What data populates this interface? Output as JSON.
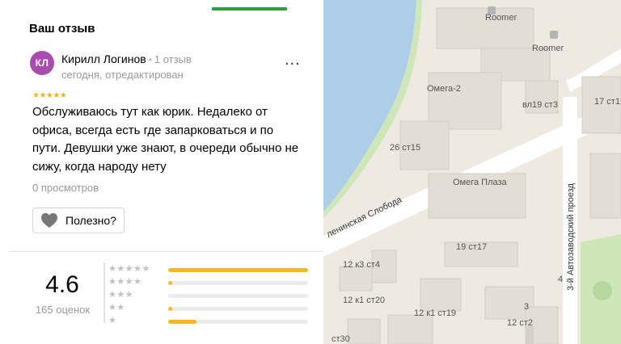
{
  "panel": {
    "section_title": "Ваш отзыв",
    "review": {
      "avatar_initials": "КЛ",
      "author_name": "Кирилл Логинов",
      "separator": "•",
      "reviews_count": "1 отзыв",
      "date": "сегодня, отредактирован",
      "more": "...",
      "stars": "★★★★★",
      "text": "Обслуживаюсь тут как юрик. Недалеко от офиса, всегда есть где запарковаться и по пути. Девушки уже знают, в очереди обычно не сижу, когда народу нету",
      "views": "0 просмотров",
      "helpful_label": "Полезно?"
    },
    "rating": {
      "value": "4.6",
      "count": "165 оценок",
      "distribution": [
        {
          "stars": "★★★★★",
          "share": 1.0
        },
        {
          "stars": "★★★★",
          "share": 0.03
        },
        {
          "stars": "★★★",
          "share": 0.0
        },
        {
          "stars": "★★",
          "share": 0.03
        },
        {
          "stars": "★",
          "share": 0.2
        }
      ]
    }
  },
  "map": {
    "labels": {
      "roomer_1": "Roomer",
      "roomer_2": "Roomer",
      "omega2": "Омега-2",
      "omega_plaza": "Омега Плаза",
      "vl19": "вл19 ст3",
      "b17": "17 ст1",
      "b26": "26 ст15",
      "b19st17": "19 ст17",
      "b12st4": "12 к3 ст4",
      "b12st20": "12 к1 ст20",
      "b12st19": "12 к1 ст19",
      "b12st2": "12 ст2",
      "b4": "4",
      "b3": "3",
      "bst30": "ст30",
      "street_sloboda": "ленинская Слобода",
      "street_proezd": "3-й Автозаводский проезд"
    }
  }
}
